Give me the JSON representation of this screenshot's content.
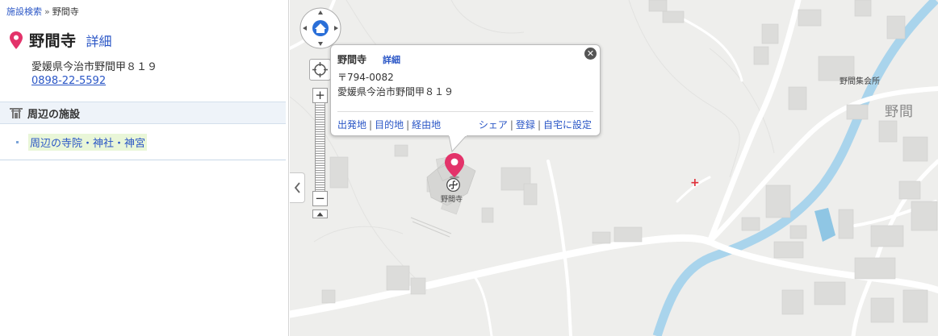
{
  "breadcrumb": {
    "root": "施設検索",
    "separator": "»",
    "current": "野間寺"
  },
  "place": {
    "name": "野間寺",
    "detail_link": "詳細",
    "address": "愛媛県今治市野間甲８１９",
    "phone": "0898-22-5592",
    "pin_icon": "map-pin-icon",
    "pin_color": "#e3336a"
  },
  "nearby": {
    "heading": "周辺の施設",
    "heading_icon": "shrine-icon",
    "items": [
      {
        "label": "周辺の寺院・神社・神宮"
      }
    ]
  },
  "popup": {
    "name": "野間寺",
    "detail_link": "詳細",
    "zip": "〒794-0082",
    "address": "愛媛県今治市野間甲８１９",
    "links_left": [
      "出発地",
      "目的地",
      "経由地"
    ],
    "links_right": [
      "シェア",
      "登録",
      "自宅に設定"
    ],
    "close_icon": "close-icon"
  },
  "map": {
    "labels": {
      "temple": "野間寺",
      "hall": "野間集会所",
      "area": "野間"
    },
    "colors": {
      "land": "#eeeeec",
      "building": "#dcdcda",
      "road": "#ffffff",
      "river": "#a9d4ec",
      "accent_link": "#2a56c6"
    },
    "controls": {
      "home_icon": "home-icon",
      "locate_icon": "crosshair-icon",
      "zoom_in": "+",
      "zoom_out": "−",
      "collapse_icon": "chevron-left-icon"
    }
  }
}
